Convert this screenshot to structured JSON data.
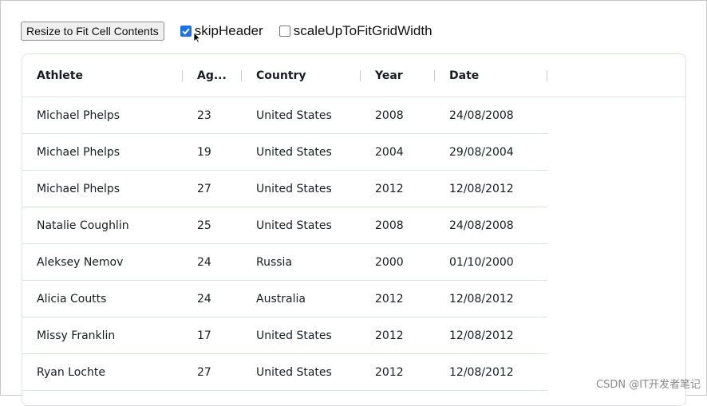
{
  "toolbar": {
    "resize_label": "Resize to Fit Cell Contents",
    "skip_header": {
      "label": "skipHeader",
      "checked": true
    },
    "scale_up": {
      "label": "scaleUpToFitGridWidth",
      "checked": false
    }
  },
  "grid": {
    "columns": [
      "Athlete",
      "Ag...",
      "Country",
      "Year",
      "Date"
    ],
    "rows": [
      [
        "Michael Phelps",
        "23",
        "United States",
        "2008",
        "24/08/2008"
      ],
      [
        "Michael Phelps",
        "19",
        "United States",
        "2004",
        "29/08/2004"
      ],
      [
        "Michael Phelps",
        "27",
        "United States",
        "2012",
        "12/08/2012"
      ],
      [
        "Natalie Coughlin",
        "25",
        "United States",
        "2008",
        "24/08/2008"
      ],
      [
        "Aleksey Nemov",
        "24",
        "Russia",
        "2000",
        "01/10/2000"
      ],
      [
        "Alicia Coutts",
        "24",
        "Australia",
        "2012",
        "12/08/2012"
      ],
      [
        "Missy Franklin",
        "17",
        "United States",
        "2012",
        "12/08/2012"
      ],
      [
        "Ryan Lochte",
        "27",
        "United States",
        "2012",
        "12/08/2012"
      ]
    ]
  },
  "watermark": "CSDN @IT开发者笔记",
  "colors": {
    "checkbox_accent": "#1a73e8",
    "grid_border": "#dde2eb"
  }
}
